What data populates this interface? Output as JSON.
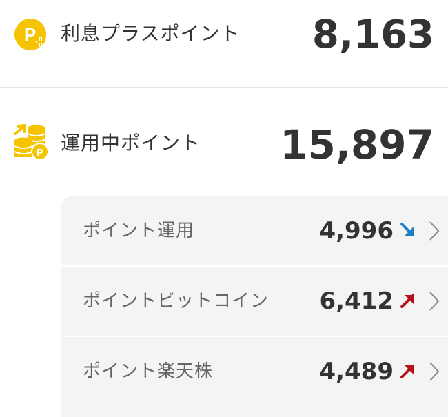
{
  "interest_plus": {
    "label": "利息プラスポイント",
    "value": "8,163",
    "icon": "p-plus-coin-icon",
    "icon_color": "#f5c400"
  },
  "running": {
    "label": "運用中ポイント",
    "value": "15,897",
    "icon": "coin-stack-p-icon",
    "icon_color": "#f5c400"
  },
  "breakdown": [
    {
      "name": "ポイント運用",
      "amount": "4,996",
      "trend": "down",
      "trend_color": "#1e7fc2"
    },
    {
      "name": "ポイントビットコイン",
      "amount": "6,412",
      "trend": "up",
      "trend_color": "#b3121c"
    },
    {
      "name": "ポイント楽天株",
      "amount": "4,489",
      "trend": "up",
      "trend_color": "#b3121c"
    }
  ]
}
